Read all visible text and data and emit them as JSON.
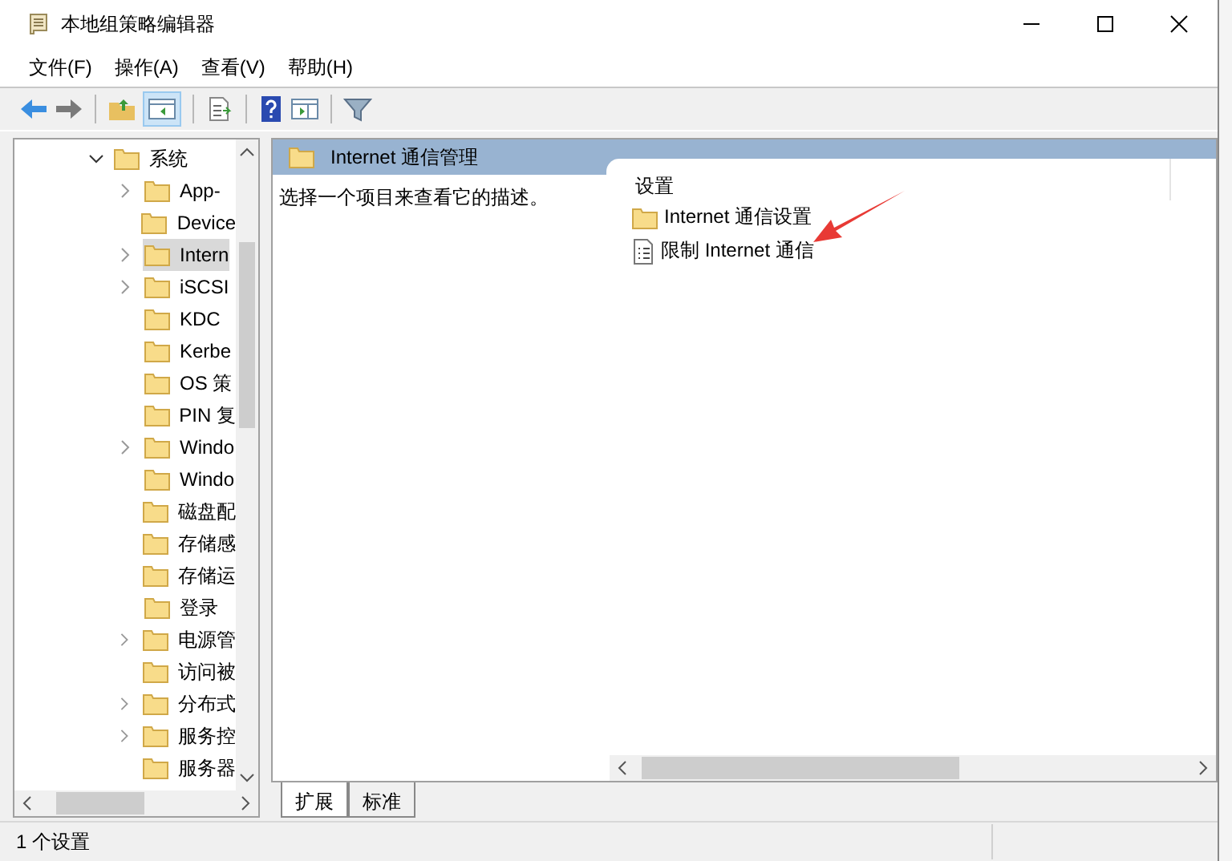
{
  "window": {
    "title": "本地组策略编辑器"
  },
  "menu": [
    "文件(F)",
    "操作(A)",
    "查看(V)",
    "帮助(H)"
  ],
  "tree": {
    "label": "系统",
    "expanded": true,
    "children": [
      {
        "label": "App-",
        "has_children": true,
        "selected": false
      },
      {
        "label": "Device",
        "has_children": false,
        "selected": false
      },
      {
        "label": "Intern",
        "has_children": true,
        "selected": true
      },
      {
        "label": "iSCSI",
        "has_children": true,
        "selected": false
      },
      {
        "label": "KDC",
        "has_children": false,
        "selected": false
      },
      {
        "label": "Kerbe",
        "has_children": false,
        "selected": false
      },
      {
        "label": "OS 策",
        "has_children": false,
        "selected": false
      },
      {
        "label": "PIN 复",
        "has_children": false,
        "selected": false
      },
      {
        "label": "Windo",
        "has_children": true,
        "selected": false
      },
      {
        "label": "Windo",
        "has_children": false,
        "selected": false
      },
      {
        "label": "磁盘配",
        "has_children": false,
        "selected": false
      },
      {
        "label": "存储感",
        "has_children": false,
        "selected": false
      },
      {
        "label": "存储运",
        "has_children": false,
        "selected": false
      },
      {
        "label": "登录",
        "has_children": false,
        "selected": false
      },
      {
        "label": "电源管",
        "has_children": true,
        "selected": false
      },
      {
        "label": "访问被",
        "has_children": false,
        "selected": false
      },
      {
        "label": "分布式",
        "has_children": true,
        "selected": false
      },
      {
        "label": "服务控",
        "has_children": true,
        "selected": false
      },
      {
        "label": "服务器",
        "has_children": false,
        "selected": false
      }
    ]
  },
  "content": {
    "header": "Internet 通信管理",
    "description": "选择一个项目来查看它的描述。",
    "column_heading": "设置",
    "items": [
      {
        "kind": "folder",
        "label": "Internet 通信设置"
      },
      {
        "kind": "setting",
        "label": "限制 Internet 通信"
      }
    ]
  },
  "tabs": [
    {
      "label": "扩展",
      "selected": true
    },
    {
      "label": "标准",
      "selected": false
    }
  ],
  "status_bar": "1 个设置"
}
